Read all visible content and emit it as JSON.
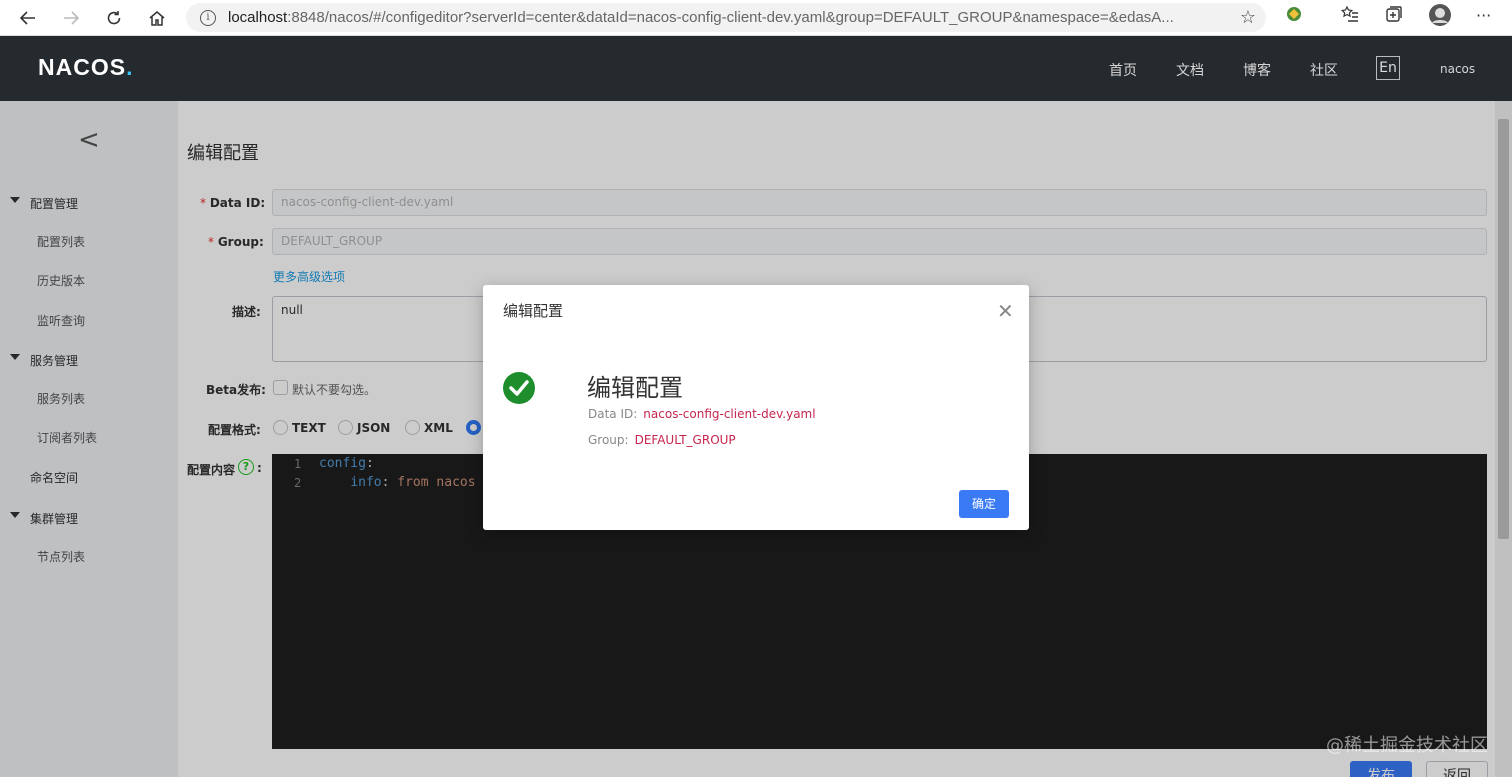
{
  "browser": {
    "url_host": "localhost",
    "url_rest": ":8848/nacos/#/configeditor?serverId=center&dataId=nacos-config-client-dev.yaml&group=DEFAULT_GROUP&namespace=&edasA..."
  },
  "header": {
    "logo": "NACOS",
    "logo_dot": ".",
    "nav": [
      "首页",
      "文档",
      "博客",
      "社区"
    ],
    "lang": "En",
    "user": "nacos"
  },
  "sidebar": {
    "collapse": "<",
    "groups": [
      {
        "label": "配置管理",
        "items": [
          "配置列表",
          "历史版本",
          "监听查询"
        ]
      },
      {
        "label": "服务管理",
        "items": [
          "服务列表",
          "订阅者列表"
        ]
      },
      {
        "label": "命名空间"
      },
      {
        "label": "集群管理",
        "items": [
          "节点列表"
        ]
      }
    ]
  },
  "form": {
    "title": "编辑配置",
    "data_id_label": "Data ID:",
    "data_id_value": "nacos-config-client-dev.yaml",
    "group_label": "Group:",
    "group_value": "DEFAULT_GROUP",
    "advanced_link": "更多高级选项",
    "desc_label": "描述:",
    "desc_value": "null",
    "beta_label": "Beta发布:",
    "beta_hint": "默认不要勾选。",
    "format_label": "配置格式:",
    "formats": [
      "TEXT",
      "JSON",
      "XML"
    ],
    "content_label": "配置内容",
    "help": "?",
    "colon": ":",
    "required_mark": "*",
    "code_lines": [
      {
        "num": "1",
        "key": "config",
        "rest": ":"
      },
      {
        "num": "2",
        "key": "info",
        "rest": ": ",
        "value": "from nacos c"
      }
    ],
    "publish_button": "发布",
    "back_button": "返回"
  },
  "dialog": {
    "title": "编辑配置",
    "message": "编辑配置",
    "data_id_label": "Data ID:",
    "data_id_value": "nacos-config-client-dev.yaml",
    "group_label": "Group:",
    "group_value": "DEFAULT_GROUP",
    "ok_button": "确定",
    "close": "✕"
  },
  "watermark": "@稀土掘金技术社区",
  "colors": {
    "header_bg": "#252a2f",
    "primary": "#3a7af5",
    "success": "#1e8e2c",
    "value_red": "#c7254e"
  }
}
